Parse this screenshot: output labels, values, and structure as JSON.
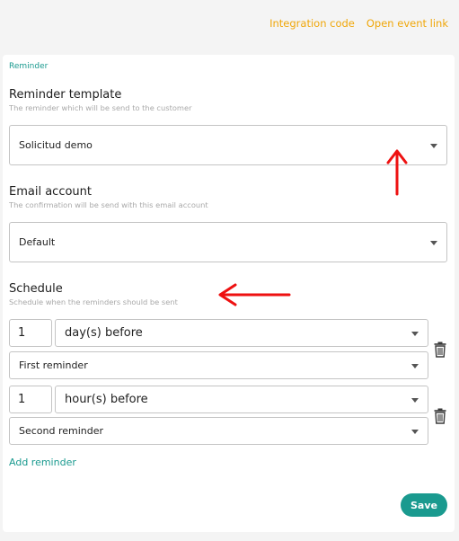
{
  "top_links": {
    "integration_code": "Integration code",
    "open_event_link": "Open event link"
  },
  "reminder_section": {
    "section_label": "Reminder",
    "template": {
      "title": "Reminder template",
      "description": "The reminder which will be send to the customer",
      "selected": "Solicitud demo"
    },
    "email_account": {
      "title": "Email account",
      "description": "The confirmation will be send with this email account",
      "selected": "Default"
    },
    "schedule": {
      "title": "Schedule",
      "description": "Schedule when the reminders should be sent",
      "reminders": [
        {
          "amount": "1",
          "unit": "day(s) before",
          "template": "First reminder"
        },
        {
          "amount": "1",
          "unit": "hour(s) before",
          "template": "Second reminder"
        }
      ]
    },
    "add_reminder_label": "Add reminder",
    "save_label": "Save"
  },
  "colors": {
    "accent": "#1a9a8f",
    "link": "#f0a70a",
    "annotation_arrow": "#ee1111"
  },
  "icons": [
    "trash-icon",
    "caret-down-icon",
    "annotation-arrow"
  ]
}
